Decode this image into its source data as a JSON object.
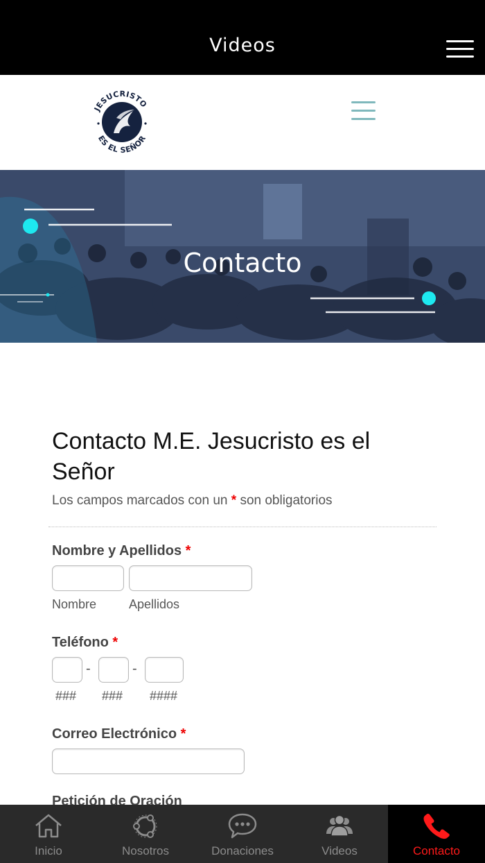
{
  "app_bar": {
    "title": "Videos",
    "menu_icon": "hamburger-menu-icon"
  },
  "site_header": {
    "logo": {
      "top_text": "JESUCRISTO",
      "bottom_text": "ES EL SEÑOR"
    },
    "menu_icon": "hamburger-menu-icon"
  },
  "hero": {
    "title": "Contacto"
  },
  "form": {
    "title": "Contacto M.E. Jesucristo es el Señor",
    "subtitle_before": "Los campos marcados con un",
    "required_mark": "*",
    "subtitle_after": "son obligatorios",
    "fields": {
      "name": {
        "label": "Nombre y Apellidos",
        "first_sublabel": "Nombre",
        "last_sublabel": "Apellidos"
      },
      "phone": {
        "label": "Teléfono",
        "separator": "-",
        "area_sublabel": "###",
        "prefix_sublabel": "###",
        "line_sublabel": "####"
      },
      "email": {
        "label": "Correo Electrónico"
      },
      "prayer": {
        "label": "Petición de Oración"
      }
    }
  },
  "tab_bar": {
    "active_color": "#ff1a1a",
    "tabs": [
      {
        "label": "Inicio",
        "icon": "home-icon"
      },
      {
        "label": "Nosotros",
        "icon": "ubuntu-circle-icon"
      },
      {
        "label": "Donaciones",
        "icon": "chat-bubble-icon"
      },
      {
        "label": "Videos",
        "icon": "group-people-icon"
      },
      {
        "label": "Contacto",
        "icon": "phone-icon"
      }
    ]
  }
}
